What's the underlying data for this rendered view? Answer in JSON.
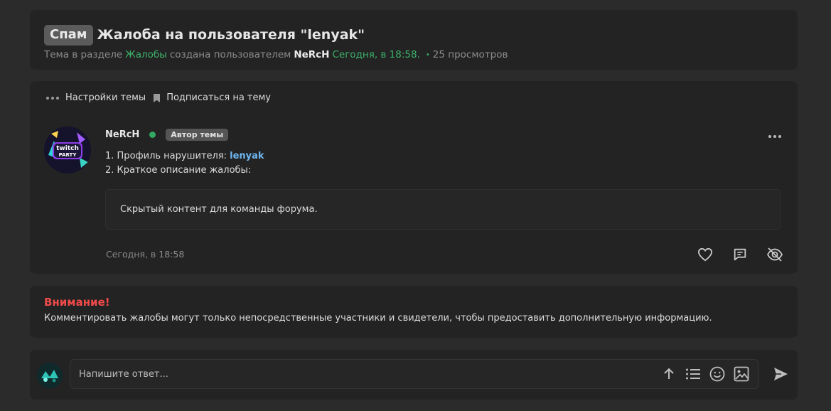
{
  "thread": {
    "prefix": "Спам",
    "title": "Жалоба на пользователя \"lenyak\"",
    "meta_prefix": "Тема в разделе",
    "section": "Жалобы",
    "meta_created": "создана пользователем",
    "creator": "NeRcH",
    "created_time": "Сегодня, в 18:58.",
    "views": "25 просмотров"
  },
  "toolbar": {
    "settings_label": "Настройки темы",
    "subscribe_label": "Подписаться на тему"
  },
  "post": {
    "author": "NeRcH",
    "author_badge": "Автор темы",
    "line1_label": "1. Профиль нарушителя: ",
    "line1_link": "lenyak",
    "line2": "2. Краткое описание жалобы:",
    "hidden_content": "Скрытый контент для команды форума.",
    "time": "Сегодня, в 18:58",
    "avatar_text_top": "twitch",
    "avatar_text_bottom": "PARTY"
  },
  "warning": {
    "title": "Внимание!",
    "text": "Комментировать жалобы могут только непосредственные участники и свидетели, чтобы предоставить дополнительную информацию."
  },
  "reply": {
    "placeholder": "Напишите ответ..."
  },
  "colors": {
    "accent_green": "#3bb36b",
    "warning_red": "#f04a4a",
    "link_blue": "#6fb7f0"
  }
}
